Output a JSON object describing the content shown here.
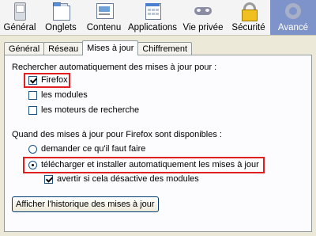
{
  "toolbar": {
    "items": [
      {
        "label": "Général",
        "icon": "general-icon"
      },
      {
        "label": "Onglets",
        "icon": "tabs-icon"
      },
      {
        "label": "Contenu",
        "icon": "content-icon"
      },
      {
        "label": "Applications",
        "icon": "applications-icon"
      },
      {
        "label": "Vie privée",
        "icon": "privacy-mask-icon"
      },
      {
        "label": "Sécurité",
        "icon": "padlock-icon"
      },
      {
        "label": "Avancé",
        "icon": "gear-icon"
      }
    ],
    "active": "Avancé"
  },
  "tabs": {
    "items": [
      "Général",
      "Réseau",
      "Mises à jour",
      "Chiffrement"
    ],
    "active": "Mises à jour"
  },
  "updates": {
    "search_heading": "Rechercher automatiquement des mises à jour pour :",
    "firefox": {
      "label": "Firefox",
      "checked": true
    },
    "modules": {
      "label": "les modules",
      "checked": false
    },
    "engines": {
      "label": "les moteurs de recherche",
      "checked": false
    },
    "when_heading": "Quand des mises à jour pour Firefox sont disponibles :",
    "ask": {
      "label": "demander ce qu'il faut faire",
      "selected": false
    },
    "auto": {
      "label": "télécharger et installer automatiquement les mises à jour",
      "selected": true
    },
    "warn": {
      "label": "avertir si cela désactive des modules",
      "checked": true
    },
    "history_button": "Afficher l'historique des mises à jour"
  },
  "colors": {
    "highlight_box": "#e02020",
    "active_toolbar": "#7e93c9",
    "window_bg": "#ece9d8"
  }
}
